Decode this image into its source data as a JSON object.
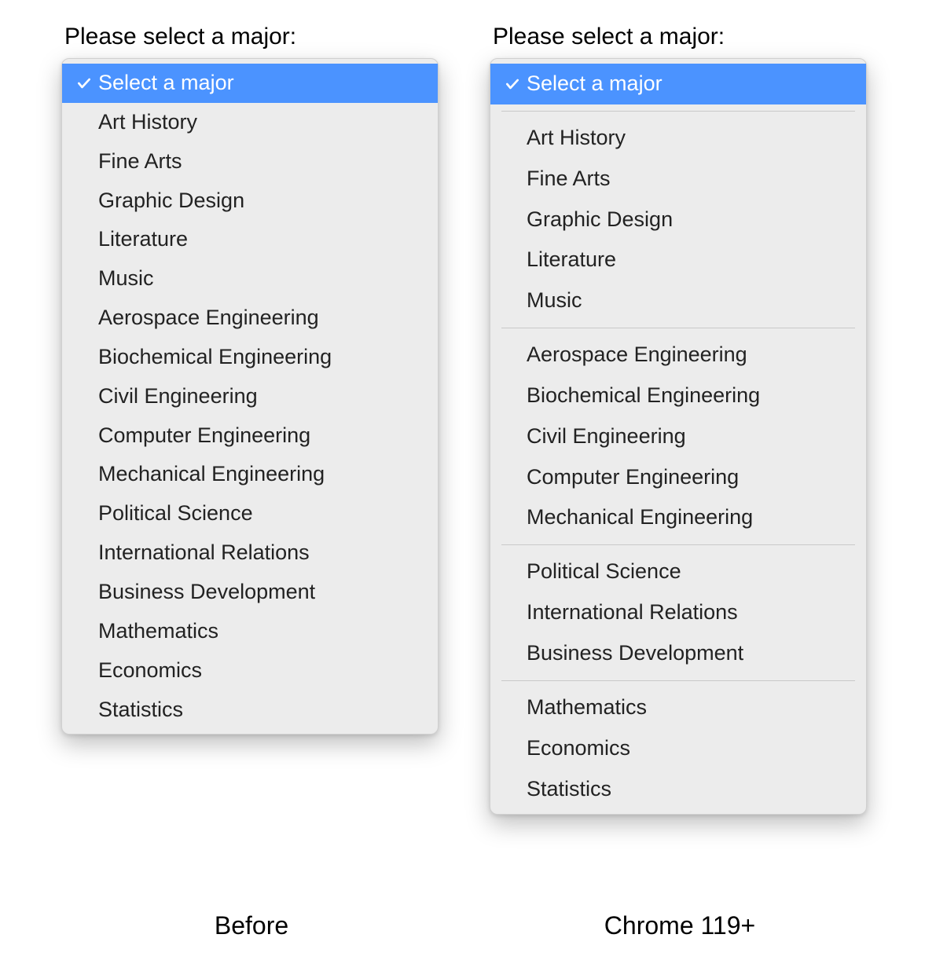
{
  "prompt": "Please select a major:",
  "selected_label": "Select a major",
  "before": {
    "caption": "Before",
    "options": [
      "Art History",
      "Fine Arts",
      "Graphic Design",
      "Literature",
      "Music",
      "Aerospace Engineering",
      "Biochemical Engineering",
      "Civil Engineering",
      "Computer Engineering",
      "Mechanical Engineering",
      "Political Science",
      "International Relations",
      "Business Development",
      "Mathematics",
      "Economics",
      "Statistics"
    ]
  },
  "after": {
    "caption": "Chrome 119+",
    "groups": [
      [
        "Art History",
        "Fine Arts",
        "Graphic Design",
        "Literature",
        "Music"
      ],
      [
        "Aerospace Engineering",
        "Biochemical Engineering",
        "Civil Engineering",
        "Computer Engineering",
        "Mechanical Engineering"
      ],
      [
        "Political Science",
        "International Relations",
        "Business Development"
      ],
      [
        "Mathematics",
        "Economics",
        "Statistics"
      ]
    ]
  },
  "colors": {
    "highlight": "#4b93ff",
    "menu_bg": "#ececec"
  }
}
